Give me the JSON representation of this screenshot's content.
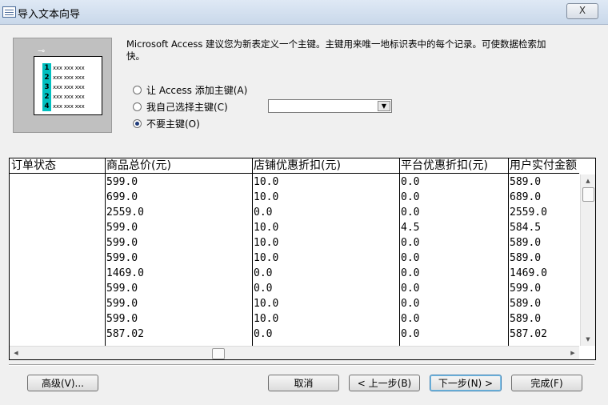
{
  "window": {
    "title": "导入文本向导",
    "close_label": "X"
  },
  "illustration": {
    "row_numbers": [
      "1",
      "2",
      "3",
      "2",
      "4"
    ],
    "row_text": "xxx xxx xxx"
  },
  "description": "Microsoft Access 建议您为新表定义一个主键。主键用来唯一地标识表中的每个记录。可使数据检索加快。",
  "primary_key_options": [
    {
      "label": "让 Access 添加主键(A)",
      "checked": false
    },
    {
      "label": "我自己选择主键(C)",
      "checked": false
    },
    {
      "label": "不要主键(O)",
      "checked": true
    }
  ],
  "key_field_combo": {
    "value": ""
  },
  "grid": {
    "columns": [
      "订单状态",
      "商品总价(元)",
      "店铺优惠折扣(元)",
      "平台优惠折扣(元)",
      "用户实付金额"
    ],
    "rows": [
      [
        "",
        "599.0",
        "10.0",
        "0.0",
        "589.0"
      ],
      [
        "",
        "699.0",
        "10.0",
        "0.0",
        "689.0"
      ],
      [
        "",
        "2559.0",
        "0.0",
        "0.0",
        "2559.0"
      ],
      [
        "",
        "599.0",
        "10.0",
        "4.5",
        "584.5"
      ],
      [
        "",
        "599.0",
        "10.0",
        "0.0",
        "589.0"
      ],
      [
        "",
        "599.0",
        "10.0",
        "0.0",
        "589.0"
      ],
      [
        "",
        "1469.0",
        "0.0",
        "0.0",
        "1469.0"
      ],
      [
        "",
        "599.0",
        "0.0",
        "0.0",
        "599.0"
      ],
      [
        "",
        "599.0",
        "10.0",
        "0.0",
        "589.0"
      ],
      [
        "",
        "599.0",
        "10.0",
        "0.0",
        "589.0"
      ],
      [
        "",
        "587.02",
        "0.0",
        "0.0",
        "587.02"
      ]
    ]
  },
  "buttons": {
    "advanced": "高级(V)...",
    "cancel": "取消",
    "back": "< 上一步(B)",
    "next": "下一步(N) >",
    "finish": "完成(F)"
  }
}
